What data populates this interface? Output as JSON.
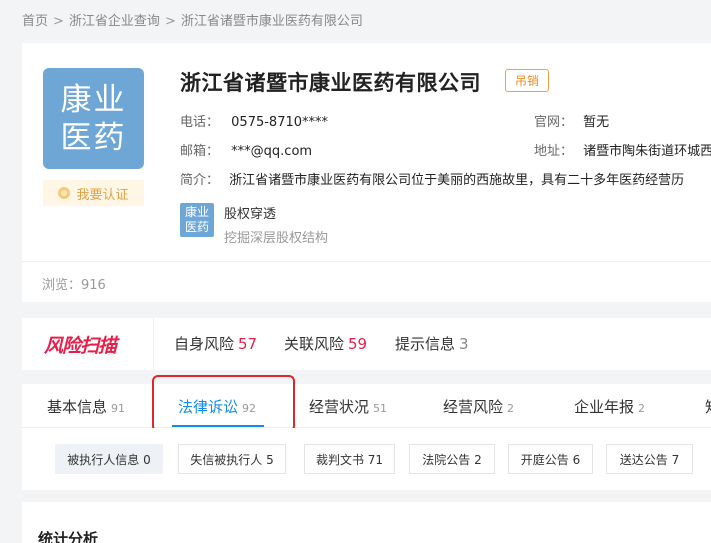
{
  "breadcrumb": {
    "home": "首页",
    "sep": ">",
    "level2": "浙江省企业查询",
    "current": "浙江省诸暨市康业医药有限公司"
  },
  "company": {
    "logo_line1": "康业",
    "logo_line2": "医药",
    "name": "浙江省诸暨市康业医药有限公司",
    "status": "吊销",
    "verify_label": "我要认证",
    "phone_label": "电话：",
    "phone": "0575-8710****",
    "email_label": "邮箱：",
    "email": "***@qq.com",
    "intro_label": "简介：",
    "intro": "浙江省诸暨市康业医药有限公司位于美丽的西施故里，具有二十多年医药经营历",
    "website_label": "官网：",
    "website": "暂无",
    "address_label": "地址：",
    "address": "诸暨市陶朱街道环城西",
    "equity_logo_line1": "康业",
    "equity_logo_line2": "医药",
    "equity_title": "股权穿透",
    "equity_sub": "挖掘深层股权结构",
    "views": "浏览：916"
  },
  "risk": {
    "brand": "风险扫描",
    "items": [
      {
        "label": "自身风险",
        "count": "57"
      },
      {
        "label": "关联风险",
        "count": "59"
      },
      {
        "label": "提示信息",
        "count": "3"
      }
    ]
  },
  "tabs": [
    {
      "label": "基本信息",
      "count": "91"
    },
    {
      "label": "法律诉讼",
      "count": "92"
    },
    {
      "label": "经营状况",
      "count": "51"
    },
    {
      "label": "经营风险",
      "count": "2"
    },
    {
      "label": "企业年报",
      "count": "2"
    },
    {
      "label": "知",
      "count": ""
    }
  ],
  "subtabs": [
    "被执行人信息 0",
    "失信被执行人 5",
    "裁判文书 71",
    "法院公告 2",
    "开庭公告 6",
    "送达公告 7"
  ],
  "stats": {
    "title": "统计分析"
  },
  "colors": {
    "accent": "#128bed",
    "risk_red": "#e7204b",
    "status_orange": "#f08a1c",
    "logo_blue": "#6ea7d6",
    "highlight_red": "#e0262b"
  }
}
